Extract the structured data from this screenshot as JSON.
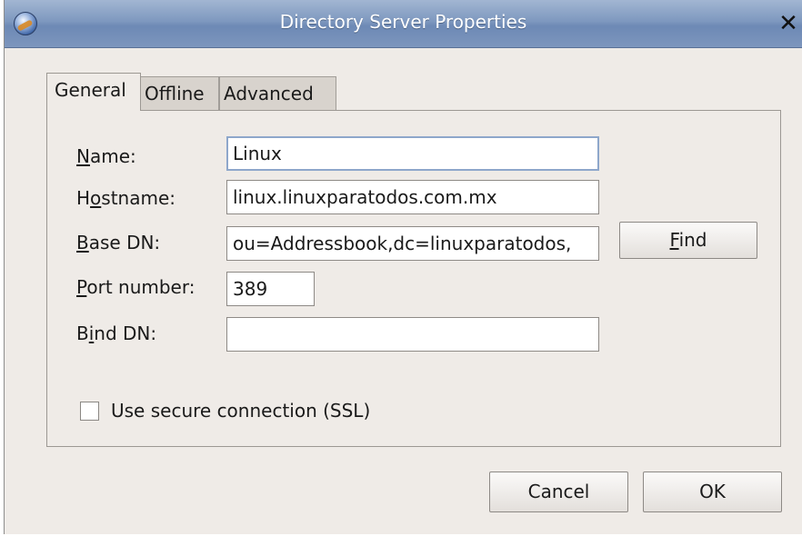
{
  "window": {
    "title": "Directory Server Properties",
    "close_glyph": "✕"
  },
  "tabs": [
    {
      "label": "General",
      "active": true
    },
    {
      "label": "Offline",
      "active": false
    },
    {
      "label": "Advanced",
      "active": false
    }
  ],
  "form": {
    "name": {
      "label_mn": "N",
      "label_rest": "ame:",
      "value": "Linux"
    },
    "hostname": {
      "label_pre": "H",
      "label_mn": "o",
      "label_rest": "stname:",
      "value": "linux.linuxparatodos.com.mx"
    },
    "base_dn": {
      "label_mn": "B",
      "label_rest": "ase DN:",
      "value": "ou=Addressbook,dc=linuxparatodos,"
    },
    "port": {
      "label_mn": "P",
      "label_rest": "ort number:",
      "value": "389"
    },
    "bind_dn": {
      "label_pre": "B",
      "label_mn": "i",
      "label_rest": "nd DN:",
      "value": ""
    },
    "find_button": {
      "label_mn": "F",
      "label_rest": "ind"
    },
    "ssl": {
      "label": "Use secure connection (SSL)",
      "checked": false
    }
  },
  "buttons": {
    "cancel": "Cancel",
    "ok": "OK"
  },
  "icons": {
    "app": "globe-icon",
    "close": "close-icon"
  }
}
